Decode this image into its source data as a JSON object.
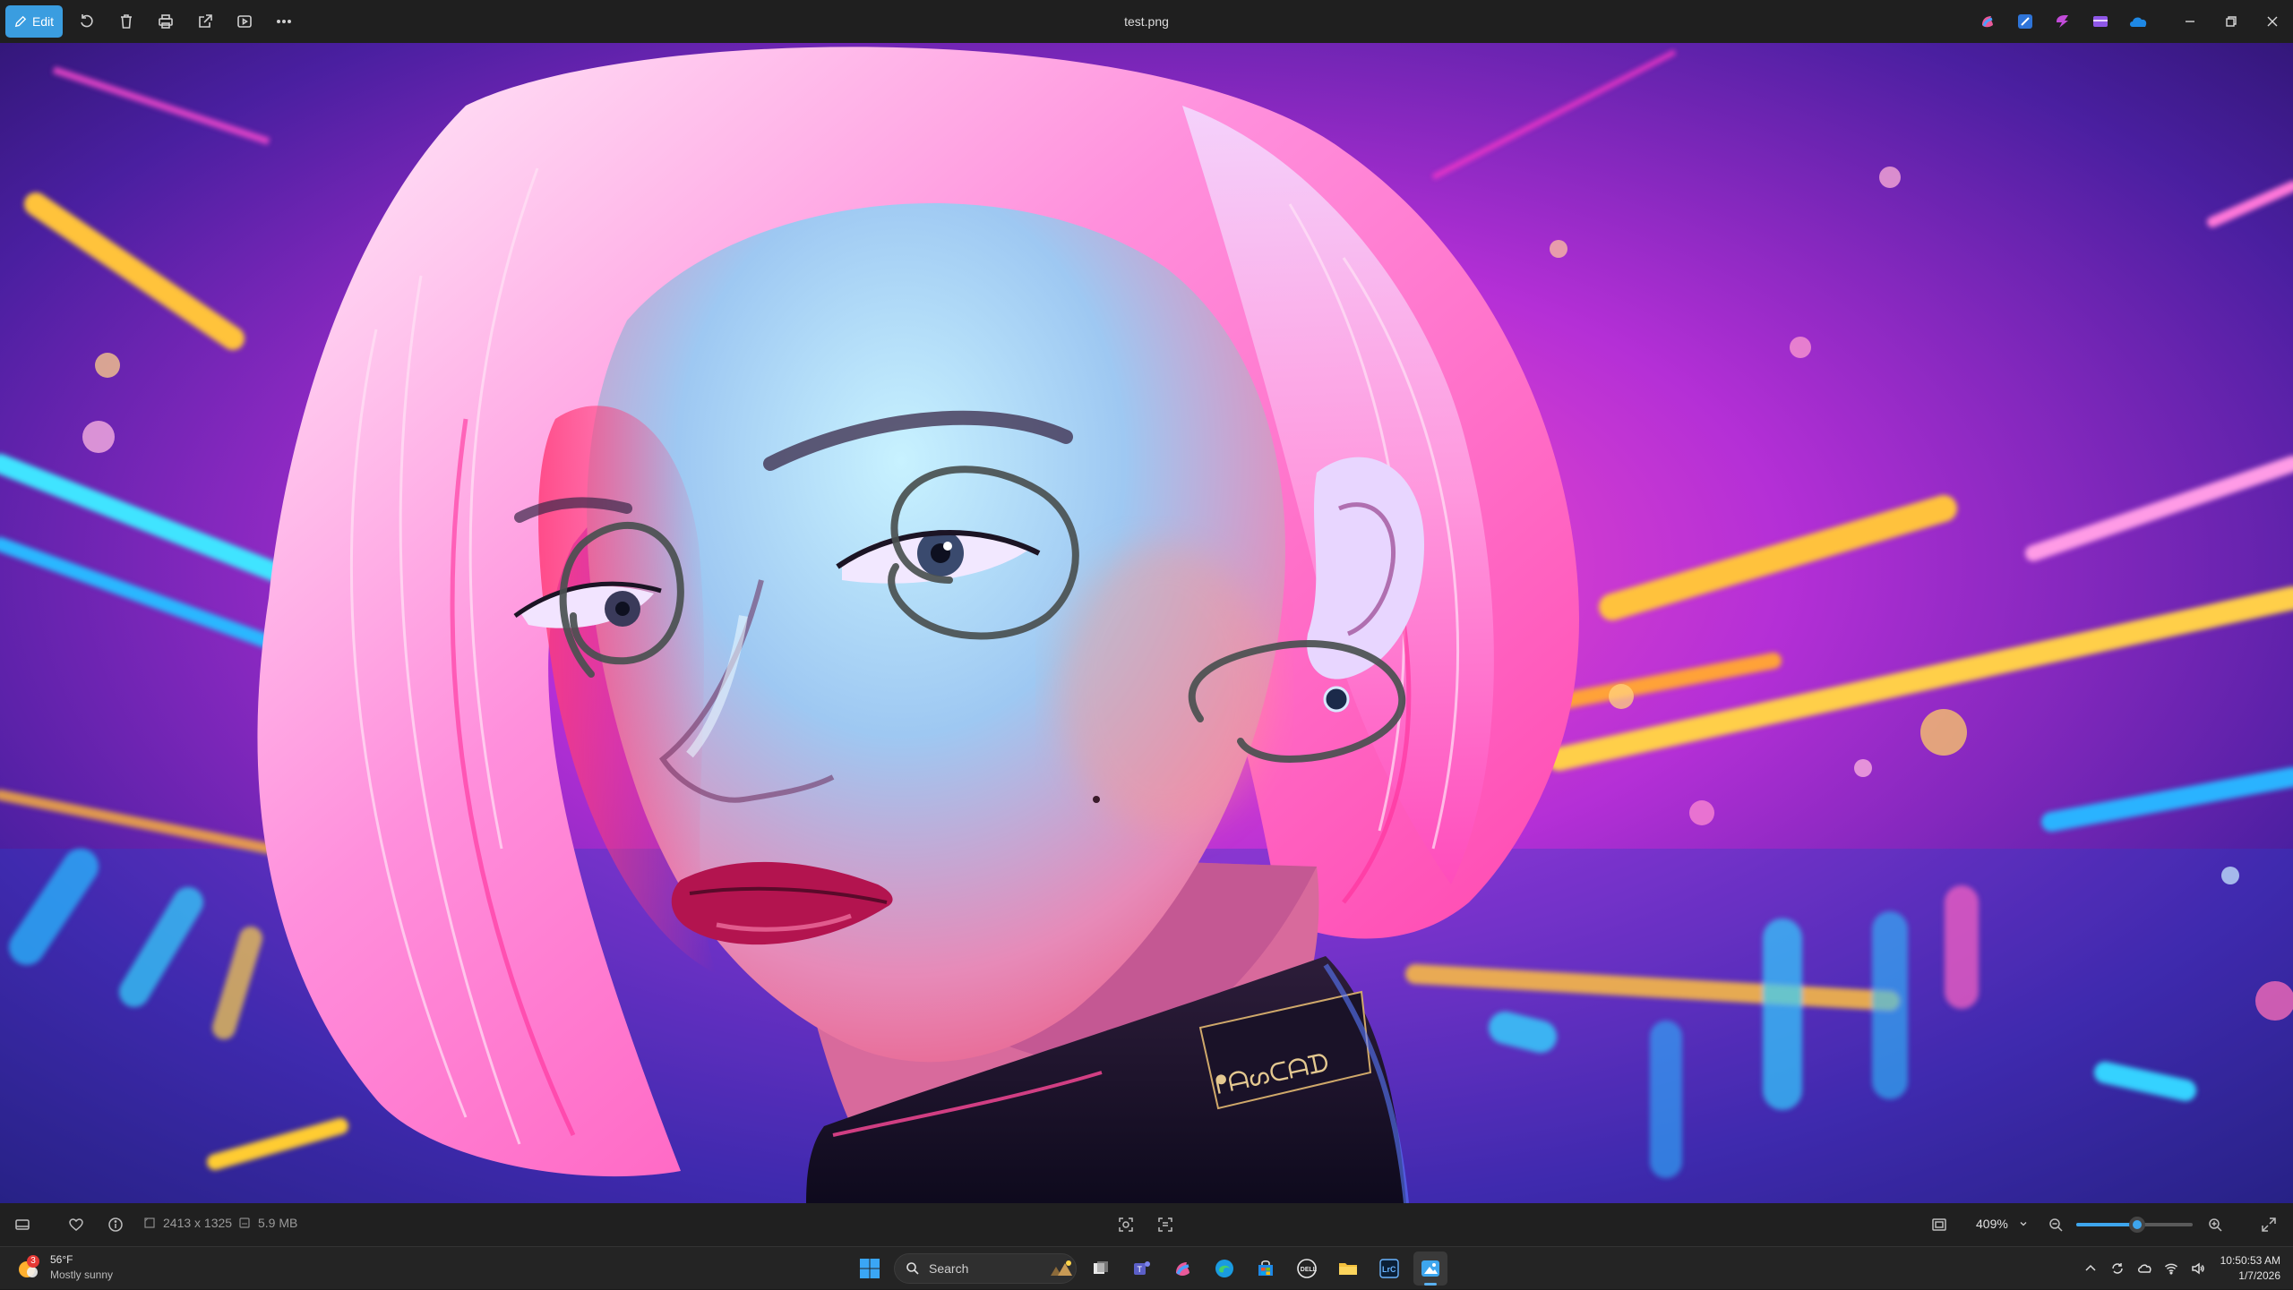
{
  "window": {
    "title": "test.png"
  },
  "toolbar": {
    "edit_label": "Edit",
    "tools": [
      {
        "name": "rotate",
        "icon": "rotate-icon"
      },
      {
        "name": "delete",
        "icon": "trash-icon"
      },
      {
        "name": "print",
        "icon": "print-icon"
      },
      {
        "name": "share",
        "icon": "share-icon"
      },
      {
        "name": "slideshow",
        "icon": "slideshow-icon"
      },
      {
        "name": "more",
        "icon": "more-icon"
      }
    ],
    "accent": "#3a9de0"
  },
  "viewer": {
    "image_dimensions": "2413 x 1325",
    "file_size": "5.9 MB",
    "zoom_level": "409%",
    "zoom_fraction": 0.52
  },
  "taskbar": {
    "weather": {
      "badge": "3",
      "temperature": "56°F",
      "condition": "Mostly sunny"
    },
    "search_placeholder": "Search",
    "time": "10:50:53 AM",
    "date": "1/7/2026"
  }
}
